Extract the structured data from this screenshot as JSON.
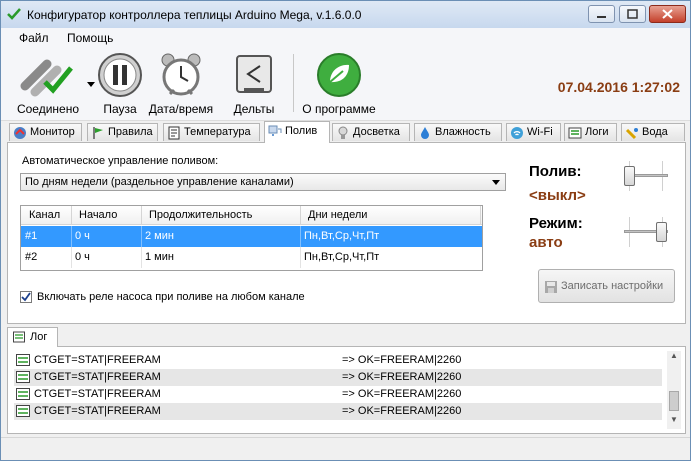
{
  "window": {
    "title": "Конфигуратор контроллера теплицы Arduino Mega, v.1.6.0.0"
  },
  "menu": [
    "Файл",
    "Помощь"
  ],
  "toolbar": {
    "connected": "Соединено",
    "pause": "Пауза",
    "datetime": "Дата/время",
    "deltas": "Дельты",
    "about": "О программе"
  },
  "clock": "07.04.2016 1:27:02",
  "tabs": [
    {
      "label": "Монитор",
      "icon": "monitor-icon"
    },
    {
      "label": "Правила",
      "icon": "flag-icon"
    },
    {
      "label": "Температура",
      "icon": "thermometer-icon"
    },
    {
      "label": "Полив",
      "icon": "watering-icon"
    },
    {
      "label": "Досветка",
      "icon": "bulb-icon"
    },
    {
      "label": "Влажность",
      "icon": "drop-icon"
    },
    {
      "label": "Wi-Fi",
      "icon": "wifi-icon"
    },
    {
      "label": "Логи",
      "icon": "logs-icon"
    },
    {
      "label": "Вода",
      "icon": "water-icon"
    }
  ],
  "active_tab": "Полив",
  "poliv": {
    "auto_label": "Автоматическое управление поливом:",
    "mode_selected": "По дням недели (раздельное управление каналами)",
    "columns": [
      "Канал",
      "Начало",
      "Продолжительность",
      "Дни недели"
    ],
    "rows": [
      {
        "channel": "#1",
        "start": "0 ч",
        "duration": "2 мин",
        "days": "Пн,Вт,Ср,Чт,Пт"
      },
      {
        "channel": "#2",
        "start": "0 ч",
        "duration": "1 мин",
        "days": "Пн,Вт,Ср,Чт,Пт"
      }
    ],
    "selected_row": 0,
    "pump_checkbox_label": "Включать реле насоса при поливе на любом канале",
    "pump_checked": true,
    "poliv_label": "Полив:",
    "poliv_value": "<выкл>",
    "poliv_slider_state": "off",
    "mode_label": "Режим:",
    "mode_value": "авто",
    "mode_slider_state": "auto",
    "save_button": "Записать настройки"
  },
  "log": {
    "tab_label": "Лог",
    "rows": [
      {
        "cmd": "CTGET=STAT|FREERAM",
        "res": "=> OK=FREERAM|2260"
      },
      {
        "cmd": "CTGET=STAT|FREERAM",
        "res": "=> OK=FREERAM|2260"
      },
      {
        "cmd": "CTGET=STAT|FREERAM",
        "res": "=> OK=FREERAM|2260"
      },
      {
        "cmd": "CTGET=STAT|FREERAM",
        "res": "=> OK=FREERAM|2260"
      }
    ]
  },
  "colors": {
    "accent_value": "#8a3d13",
    "selection": "#3399ff"
  }
}
